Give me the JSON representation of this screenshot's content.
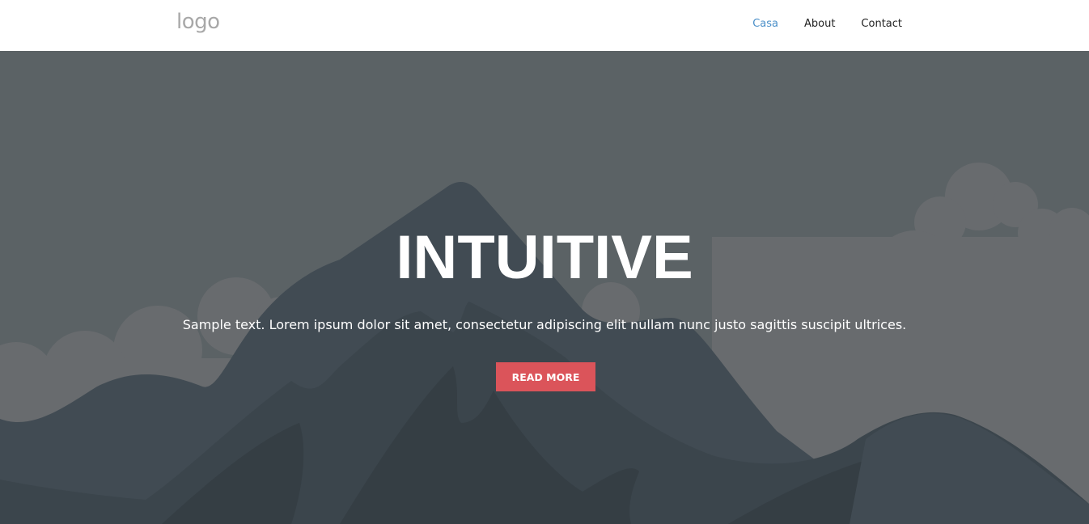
{
  "header": {
    "logo_text": "logo",
    "nav": [
      {
        "label": "Casa",
        "active": true
      },
      {
        "label": "About",
        "active": false
      },
      {
        "label": "Contact",
        "active": false
      }
    ]
  },
  "hero": {
    "title": "INTUITIVE",
    "text": "Sample text. Lorem ipsum dolor sit amet, consectetur adipiscing elit nullam nunc justo sagittis suscipit ultrices.",
    "button_label": "READ MORE"
  },
  "colors": {
    "nav_active": "#4a8fc8",
    "nav_text": "#222222",
    "logo": "#a8a8a8",
    "button": "#db545a",
    "hero_sky": "#5b6265",
    "clouds": "#686b6e",
    "mountain_far": "#414b53",
    "mountain_mid": "#3b454c",
    "mountain_near": "#353e44"
  }
}
